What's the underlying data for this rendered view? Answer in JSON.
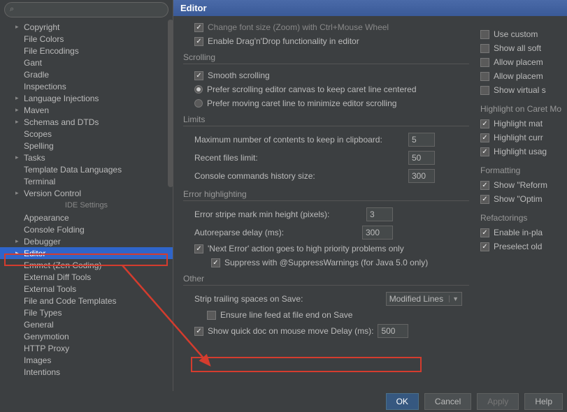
{
  "header": {
    "title": "Editor"
  },
  "search": {
    "placeholder": ""
  },
  "sidebar": {
    "items": [
      {
        "label": "Copyright",
        "arrow": true
      },
      {
        "label": "File Colors"
      },
      {
        "label": "File Encodings"
      },
      {
        "label": "Gant"
      },
      {
        "label": "Gradle"
      },
      {
        "label": "Inspections"
      },
      {
        "label": "Language Injections",
        "arrow": true
      },
      {
        "label": "Maven",
        "arrow": true
      },
      {
        "label": "Schemas and DTDs",
        "arrow": true
      },
      {
        "label": "Scopes"
      },
      {
        "label": "Spelling"
      },
      {
        "label": "Tasks",
        "arrow": true
      },
      {
        "label": "Template Data Languages"
      },
      {
        "label": "Terminal"
      },
      {
        "label": "Version Control",
        "arrow": true
      }
    ],
    "ide_label": "IDE Settings",
    "ide_items": [
      {
        "label": "Appearance"
      },
      {
        "label": "Console Folding"
      },
      {
        "label": "Debugger",
        "arrow": true
      },
      {
        "label": "Editor",
        "arrow": true,
        "selected": true
      },
      {
        "label": "Emmet (Zen Coding)"
      },
      {
        "label": "External Diff Tools"
      },
      {
        "label": "External Tools"
      },
      {
        "label": "File and Code Templates"
      },
      {
        "label": "File Types"
      },
      {
        "label": "General"
      },
      {
        "label": "Genymotion"
      },
      {
        "label": "HTTP Proxy"
      },
      {
        "label": "Images"
      },
      {
        "label": "Intentions"
      }
    ]
  },
  "top_checks": {
    "change_font": "Change font size (Zoom) with Ctrl+Mouse Wheel",
    "drag_drop": "Enable Drag'n'Drop functionality in editor"
  },
  "scrolling": {
    "title": "Scrolling",
    "smooth": "Smooth scrolling",
    "r1": "Prefer scrolling editor canvas to keep caret line centered",
    "r2": "Prefer moving caret line to minimize editor scrolling"
  },
  "limits": {
    "title": "Limits",
    "clipboard_lbl": "Maximum number of contents to keep in clipboard:",
    "clipboard_val": "5",
    "recent_lbl": "Recent files limit:",
    "recent_val": "50",
    "console_lbl": "Console commands history size:",
    "console_val": "300"
  },
  "err": {
    "title": "Error highlighting",
    "stripe_lbl": "Error stripe mark min height (pixels):",
    "stripe_val": "3",
    "reparse_lbl": "Autoreparse delay (ms):",
    "reparse_val": "300",
    "next_error": "'Next Error' action goes to high priority problems only",
    "suppress": "Suppress with @SuppressWarnings (for Java 5.0 only)"
  },
  "other": {
    "title": "Other",
    "strip_lbl": "Strip trailing spaces on Save:",
    "strip_val": "Modified Lines",
    "ensure": "Ensure line feed at file end on Save",
    "quickdoc": "Show quick doc on mouse move   Delay (ms):",
    "quickdoc_val": "500"
  },
  "right": {
    "use_custom": "Use custom",
    "show_soft": "Show all soft",
    "allow_p1": "Allow placem",
    "allow_p2": "Allow placem",
    "show_virt": "Show virtual s",
    "hilite_title": "Highlight on Caret Mo",
    "hilite_mat": "Highlight mat",
    "hilite_cur": "Highlight curr",
    "hilite_usa": "Highlight usag",
    "fmt_title": "Formatting",
    "reform": "Show \"Reform",
    "optim": "Show \"Optim",
    "refac_title": "Refactorings",
    "enable_inp": "Enable in-pla",
    "preselect": "Preselect old"
  },
  "buttons": {
    "ok": "OK",
    "cancel": "Cancel",
    "apply": "Apply",
    "help": "Help"
  }
}
